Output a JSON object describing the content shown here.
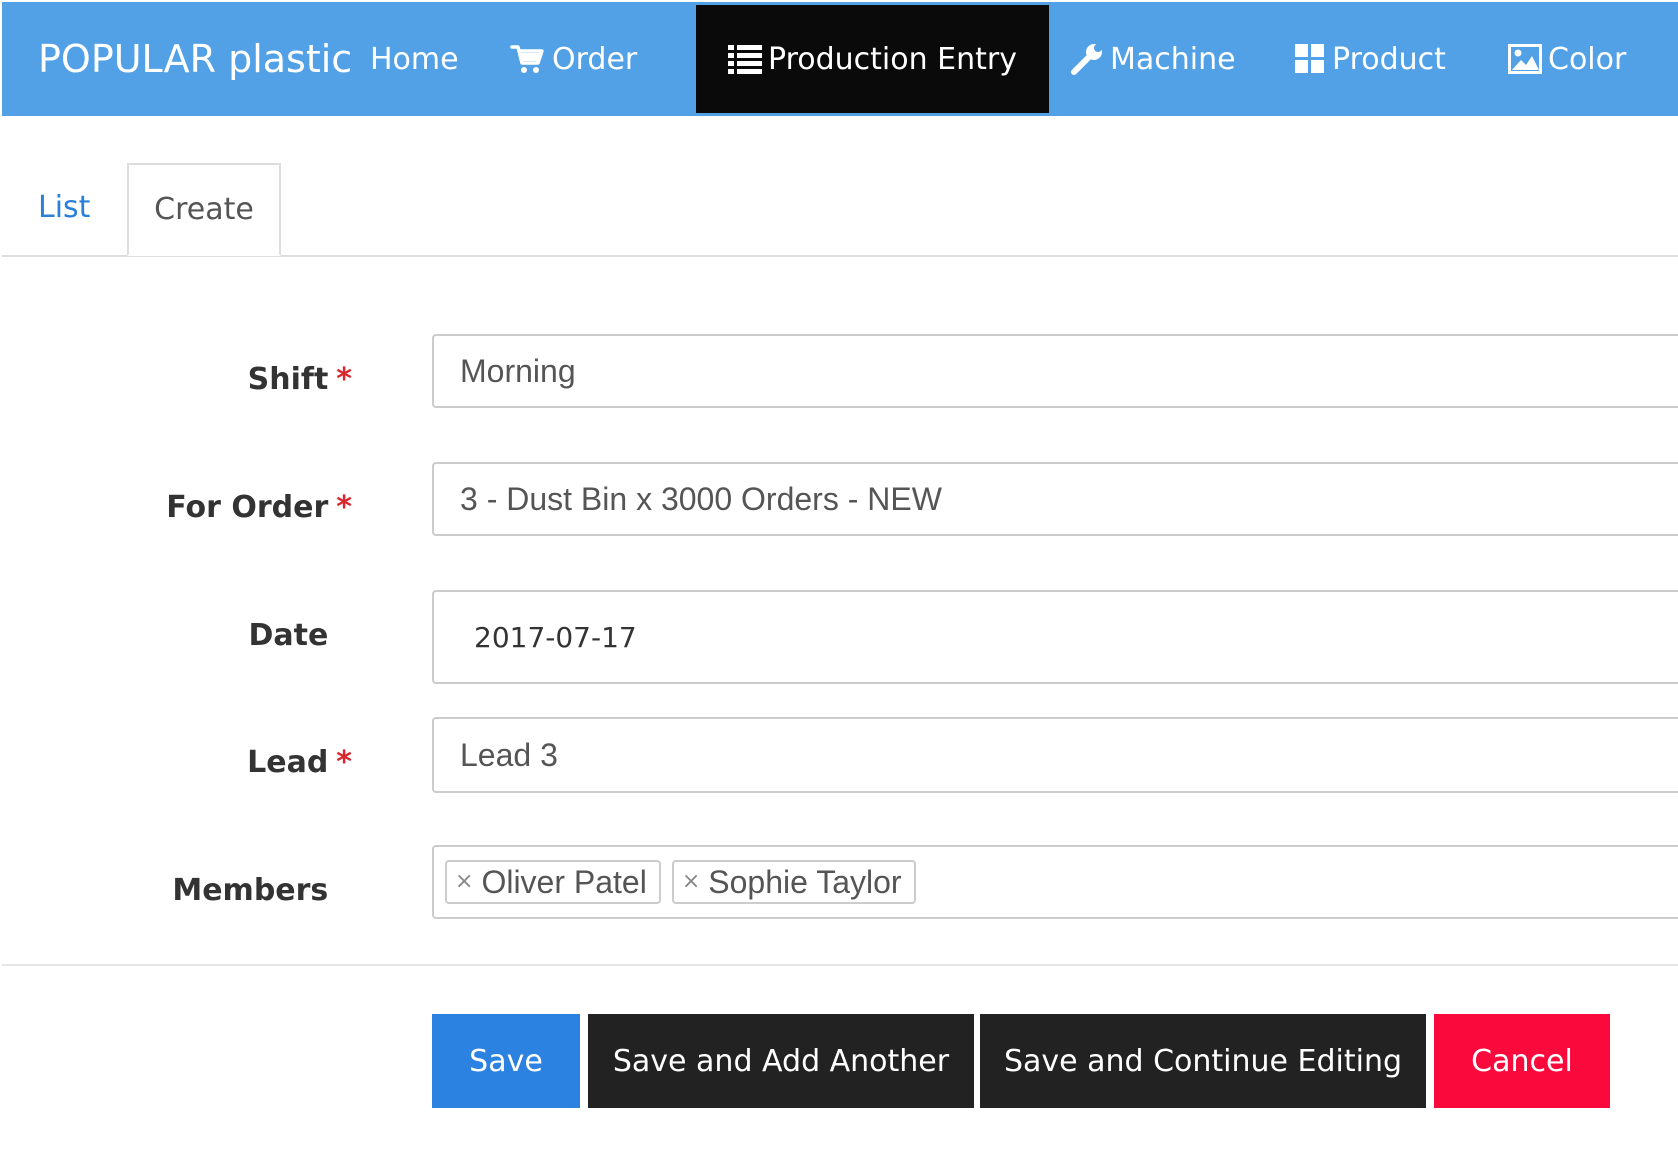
{
  "navbar": {
    "brand": "POPULAR plastic",
    "items": [
      {
        "label": "Home",
        "icon": ""
      },
      {
        "label": "Order",
        "icon": "cart-icon"
      },
      {
        "label": "Production Entry",
        "icon": "list-icon",
        "active": true
      },
      {
        "label": "Machine",
        "icon": "wrench-icon"
      },
      {
        "label": "Product",
        "icon": "grid-icon"
      },
      {
        "label": "Color",
        "icon": "image-icon"
      }
    ],
    "colors": {
      "background": "#52a0e5",
      "active_background": "#0a0a0a",
      "text": "#ffffff"
    }
  },
  "tabs": {
    "items": [
      {
        "label": "List",
        "active": false
      },
      {
        "label": "Create",
        "active": true
      }
    ]
  },
  "form": {
    "fields": {
      "shift": {
        "label": "Shift",
        "required": true,
        "value": "Morning"
      },
      "order": {
        "label": "For Order",
        "required": true,
        "value": "3 - Dust Bin x 3000 Orders - NEW"
      },
      "date": {
        "label": "Date",
        "required": false,
        "value": "2017-07-17"
      },
      "lead": {
        "label": "Lead",
        "required": true,
        "value": "Lead 3"
      },
      "members": {
        "label": "Members",
        "required": false,
        "values": [
          "Oliver Patel",
          "Sophie Taylor"
        ]
      }
    },
    "required_mark": "*",
    "remove_glyph": "×"
  },
  "buttons": {
    "save": "Save",
    "save_add": "Save and Add Another",
    "save_continue": "Save and Continue Editing",
    "cancel": "Cancel",
    "colors": {
      "save": "#2b82e0",
      "dark": "#222222",
      "cancel": "#fa0a3c"
    }
  }
}
